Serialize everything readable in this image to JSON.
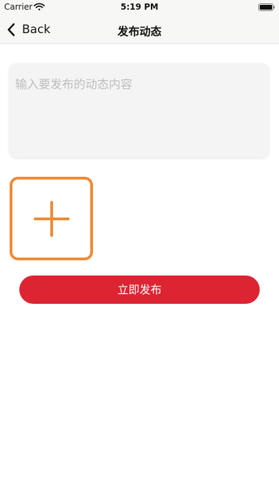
{
  "status_bar": {
    "carrier": "Carrier",
    "time": "5:19 PM"
  },
  "nav": {
    "back_label": "Back",
    "title": "发布动态"
  },
  "post": {
    "content_placeholder": "输入要发布的动态内容",
    "content_value": ""
  },
  "actions": {
    "publish_label": "立即发布"
  },
  "colors": {
    "accent_orange": "#ee8a35",
    "publish_red": "#dc2432"
  },
  "icons": {
    "add_image": "plus-icon",
    "back": "chevron-left-icon"
  }
}
